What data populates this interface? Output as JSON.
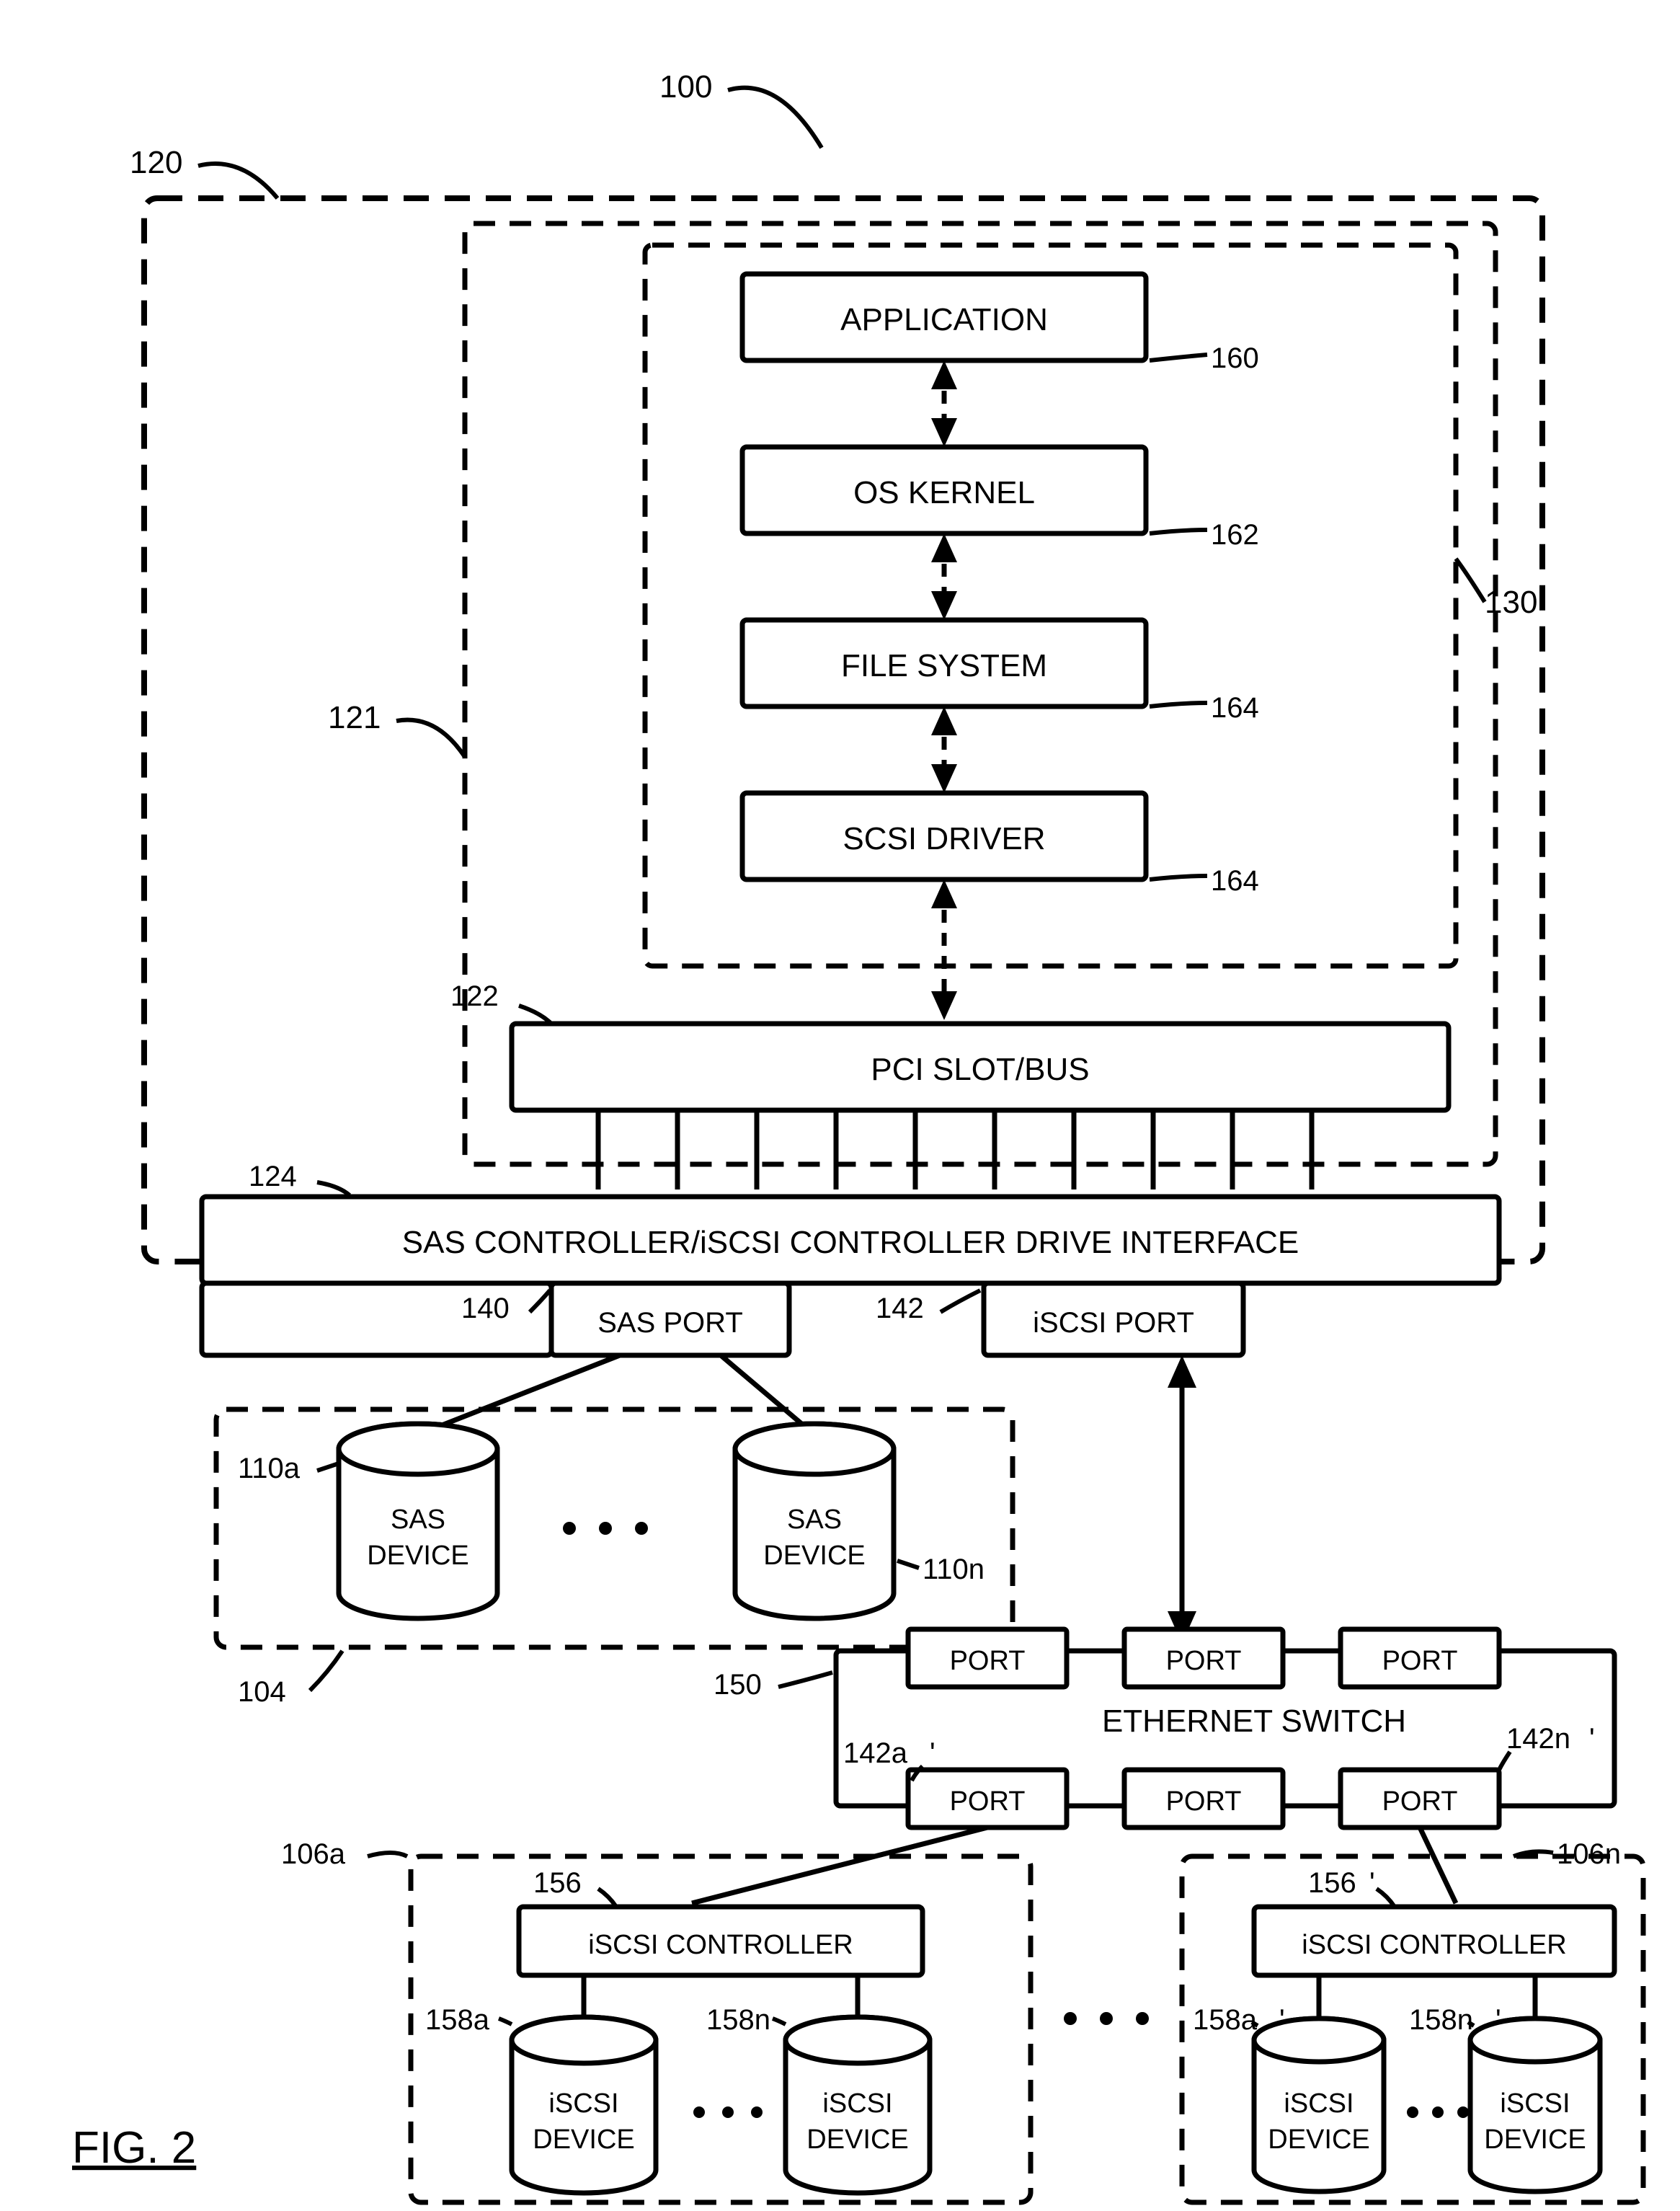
{
  "figure": "FIG. 2",
  "refs": {
    "r100": "100",
    "r120": "120",
    "r121": "121",
    "r122": "122",
    "r124": "124",
    "r130": "130",
    "r160": "160",
    "r162": "162",
    "r164a": "164",
    "r164b": "164",
    "r140": "140",
    "r142": "142",
    "r104": "104",
    "r110a": "110a",
    "r110n": "110n",
    "r150": "150",
    "r142a": "142a",
    "r142n": "142n",
    "r106a": "106a",
    "r106n": "106n",
    "r156": "156",
    "r156p": "156",
    "r158a": "158a",
    "r158n": "158n",
    "r158ap": "158a",
    "r158np": "158n"
  },
  "blocks": {
    "application": "APPLICATION",
    "oskernel": "OS KERNEL",
    "filesystem": "FILE SYSTEM",
    "scsidriver": "SCSI DRIVER",
    "pcislot": "PCI SLOT/BUS",
    "drvif": "SAS CONTROLLER/iSCSI CONTROLLER DRIVE INTERFACE",
    "sasport": "SAS PORT",
    "iscsiport": "iSCSI PORT",
    "sasdev1": "SAS",
    "sasdev2": "DEVICE",
    "ethswitch": "ETHERNET SWITCH",
    "port": "PORT",
    "iscsictrl": "iSCSI CONTROLLER",
    "iscsidev1": "iSCSI",
    "iscsidev2": "DEVICE",
    "ellipsis": ". . ."
  }
}
